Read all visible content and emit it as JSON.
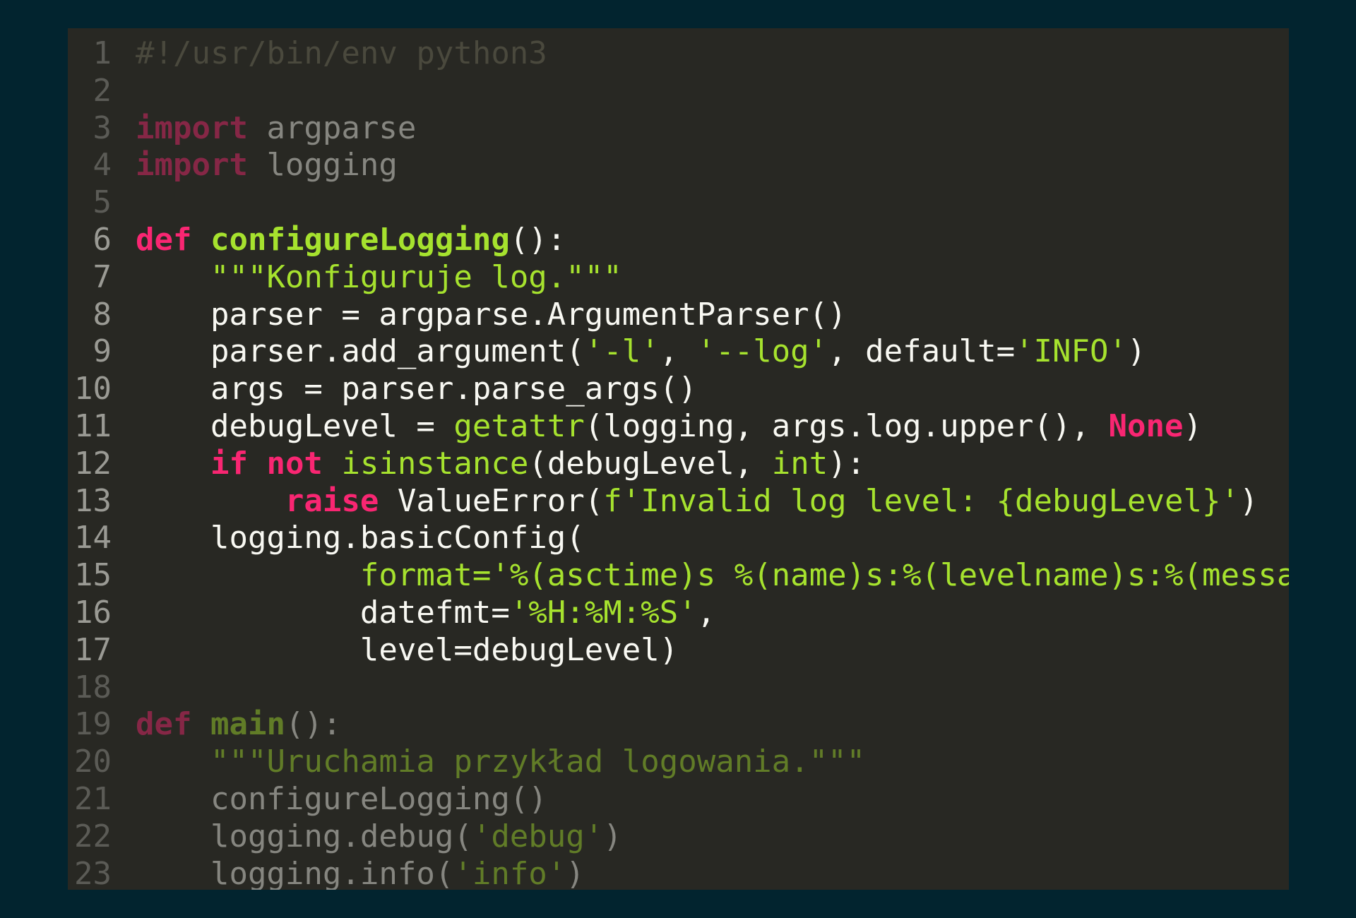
{
  "editor": {
    "colors": {
      "background": "#282823",
      "page": "#02242f",
      "keyword": "#f92672",
      "function": "#a6e22e",
      "string": "#a6e22e",
      "comment": "#75715e",
      "text": "#f8f8f2"
    },
    "lines": [
      {
        "n": "1",
        "dim": true,
        "tokens": [
          {
            "t": "#!/usr/bin/env python3",
            "c": "cm"
          }
        ]
      },
      {
        "n": "2",
        "dim": true,
        "tokens": []
      },
      {
        "n": "3",
        "dim": true,
        "tokens": [
          {
            "t": "import",
            "c": "kw"
          },
          {
            "t": " argparse",
            "c": "p"
          }
        ]
      },
      {
        "n": "4",
        "dim": true,
        "tokens": [
          {
            "t": "import",
            "c": "kw"
          },
          {
            "t": " logging",
            "c": "p"
          }
        ]
      },
      {
        "n": "5",
        "dim": true,
        "tokens": []
      },
      {
        "n": "6",
        "dim": false,
        "tokens": [
          {
            "t": "def",
            "c": "kw"
          },
          {
            "t": " ",
            "c": "p"
          },
          {
            "t": "configureLogging",
            "c": "fn"
          },
          {
            "t": "():",
            "c": "p"
          }
        ]
      },
      {
        "n": "7",
        "dim": false,
        "tokens": [
          {
            "t": "    ",
            "c": "p"
          },
          {
            "t": "\"\"\"Konfiguruje log.\"\"\"",
            "c": "str"
          }
        ]
      },
      {
        "n": "8",
        "dim": false,
        "tokens": [
          {
            "t": "    parser = argparse.ArgumentParser()",
            "c": "p"
          }
        ]
      },
      {
        "n": "9",
        "dim": false,
        "tokens": [
          {
            "t": "    parser.add_argument(",
            "c": "p"
          },
          {
            "t": "'-l'",
            "c": "str"
          },
          {
            "t": ", ",
            "c": "p"
          },
          {
            "t": "'--log'",
            "c": "str"
          },
          {
            "t": ", default=",
            "c": "p"
          },
          {
            "t": "'INFO'",
            "c": "str"
          },
          {
            "t": ")",
            "c": "p"
          }
        ]
      },
      {
        "n": "10",
        "dim": false,
        "tokens": [
          {
            "t": "    args = parser.parse_args()",
            "c": "p"
          }
        ]
      },
      {
        "n": "11",
        "dim": false,
        "tokens": [
          {
            "t": "    debugLevel = ",
            "c": "p"
          },
          {
            "t": "getattr",
            "c": "bi"
          },
          {
            "t": "(logging, args.log.upper(), ",
            "c": "p"
          },
          {
            "t": "None",
            "c": "const"
          },
          {
            "t": ")",
            "c": "p"
          }
        ]
      },
      {
        "n": "12",
        "dim": false,
        "tokens": [
          {
            "t": "    ",
            "c": "p"
          },
          {
            "t": "if",
            "c": "kw"
          },
          {
            "t": " ",
            "c": "p"
          },
          {
            "t": "not",
            "c": "kw"
          },
          {
            "t": " ",
            "c": "p"
          },
          {
            "t": "isinstance",
            "c": "bi"
          },
          {
            "t": "(debugLevel, ",
            "c": "p"
          },
          {
            "t": "int",
            "c": "bi"
          },
          {
            "t": "):",
            "c": "p"
          }
        ]
      },
      {
        "n": "13",
        "dim": false,
        "tokens": [
          {
            "t": "        ",
            "c": "p"
          },
          {
            "t": "raise",
            "c": "kw"
          },
          {
            "t": " ValueError(",
            "c": "p"
          },
          {
            "t": "f'Invalid log level: {debugLevel}'",
            "c": "str"
          },
          {
            "t": ")",
            "c": "p"
          }
        ]
      },
      {
        "n": "14",
        "dim": false,
        "tokens": [
          {
            "t": "    logging.basicConfig(",
            "c": "p"
          }
        ]
      },
      {
        "n": "15",
        "dim": false,
        "tokens": [
          {
            "t": "            format=",
            "c": "str"
          },
          {
            "t": "'%(asctime)s %(name)s:%(levelname)s:%(messa",
            "c": "str"
          }
        ]
      },
      {
        "n": "16",
        "dim": false,
        "tokens": [
          {
            "t": "            datefmt=",
            "c": "p"
          },
          {
            "t": "'%H:%M:%S'",
            "c": "str"
          },
          {
            "t": ",",
            "c": "p"
          }
        ]
      },
      {
        "n": "17",
        "dim": false,
        "tokens": [
          {
            "t": "            level=debugLevel)",
            "c": "p"
          }
        ]
      },
      {
        "n": "18",
        "dim": true,
        "tokens": []
      },
      {
        "n": "19",
        "dim": true,
        "tokens": [
          {
            "t": "def",
            "c": "kw"
          },
          {
            "t": " ",
            "c": "p"
          },
          {
            "t": "main",
            "c": "fn"
          },
          {
            "t": "():",
            "c": "p"
          }
        ]
      },
      {
        "n": "20",
        "dim": true,
        "tokens": [
          {
            "t": "    ",
            "c": "p"
          },
          {
            "t": "\"\"\"Uruchamia przykład logowania.\"\"\"",
            "c": "str"
          }
        ]
      },
      {
        "n": "21",
        "dim": true,
        "tokens": [
          {
            "t": "    configureLogging()",
            "c": "p"
          }
        ]
      },
      {
        "n": "22",
        "dim": true,
        "tokens": [
          {
            "t": "    logging.debug(",
            "c": "p"
          },
          {
            "t": "'debug'",
            "c": "str"
          },
          {
            "t": ")",
            "c": "p"
          }
        ]
      },
      {
        "n": "23",
        "dim": true,
        "tokens": [
          {
            "t": "    logging.info(",
            "c": "p"
          },
          {
            "t": "'info'",
            "c": "str"
          },
          {
            "t": ")",
            "c": "p"
          }
        ]
      }
    ]
  }
}
